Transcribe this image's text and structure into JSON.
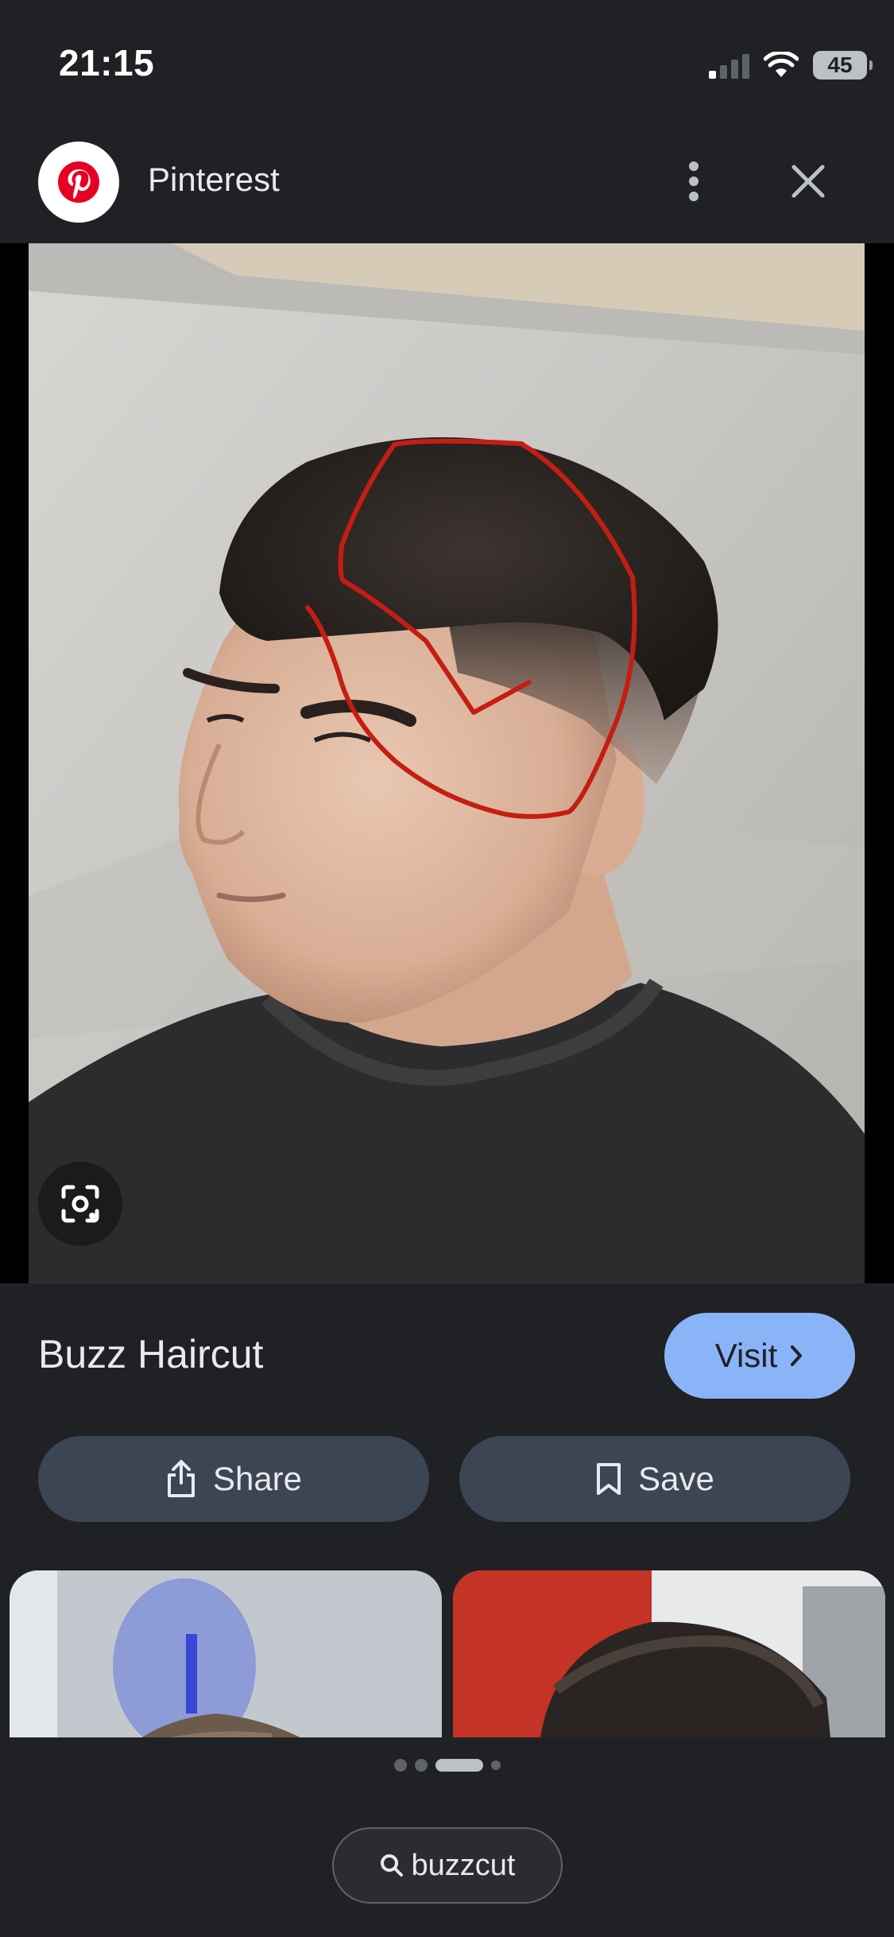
{
  "status_bar": {
    "time": "21:15",
    "battery": "45",
    "icons": [
      "signal-icon",
      "wifi-icon",
      "battery-icon"
    ]
  },
  "header": {
    "site_name": "Pinterest",
    "logo_icon": "pinterest-logo",
    "more_icon": "more-vert-icon",
    "close_icon": "close-icon"
  },
  "image": {
    "description_icon": "google-lens-icon"
  },
  "result": {
    "title": "Buzz Haircut",
    "visit_label": "Visit",
    "share_label": "Share",
    "save_label": "Save"
  },
  "pagination": {
    "total": 4,
    "active": 3
  },
  "search_chip": {
    "label": "buzzcut"
  },
  "colors": {
    "background": "#202124",
    "accent": "#8ab4f8",
    "button": "#3c4554",
    "annotation": "#c41e12",
    "pinterest": "#e60023"
  }
}
